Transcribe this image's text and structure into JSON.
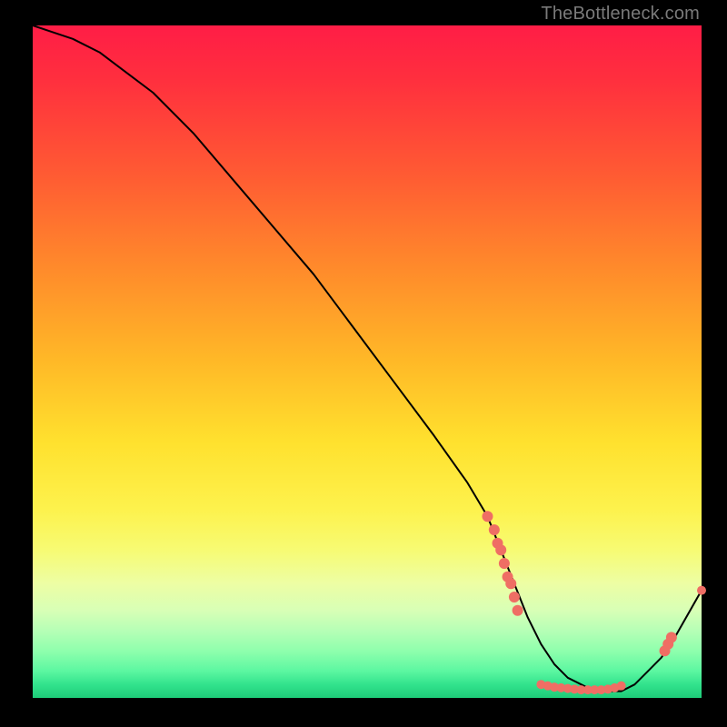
{
  "watermark": "TheBottleneck.com",
  "chart_data": {
    "type": "line",
    "title": "",
    "xlabel": "",
    "ylabel": "",
    "xlim": [
      0,
      100
    ],
    "ylim": [
      0,
      100
    ],
    "grid": false,
    "series": [
      {
        "name": "curve",
        "color": "#000000",
        "x": [
          0,
          3,
          6,
          10,
          14,
          18,
          24,
          30,
          36,
          42,
          48,
          54,
          60,
          65,
          68,
          70,
          72,
          74,
          76,
          78,
          80,
          82,
          84,
          86,
          88,
          90,
          92,
          94,
          96,
          100
        ],
        "y": [
          100,
          99,
          98,
          96,
          93,
          90,
          84,
          77,
          70,
          63,
          55,
          47,
          39,
          32,
          27,
          22,
          17,
          12,
          8,
          5,
          3,
          2,
          1,
          1,
          1,
          2,
          4,
          6,
          9,
          16
        ]
      }
    ],
    "markers": [
      {
        "name": "cluster-descent",
        "color": "#ef6e64",
        "radius_px": 6,
        "points": [
          [
            68,
            27
          ],
          [
            69,
            25
          ],
          [
            69.5,
            23
          ],
          [
            70,
            22
          ],
          [
            70.5,
            20
          ],
          [
            71,
            18
          ],
          [
            71.5,
            17
          ],
          [
            72,
            15
          ],
          [
            72.5,
            13
          ]
        ]
      },
      {
        "name": "cluster-valley",
        "color": "#ef6e64",
        "radius_px": 5,
        "points": [
          [
            76,
            2.0
          ],
          [
            77,
            1.8
          ],
          [
            78,
            1.6
          ],
          [
            79,
            1.5
          ],
          [
            80,
            1.4
          ],
          [
            81,
            1.3
          ],
          [
            82,
            1.2
          ],
          [
            83,
            1.2
          ],
          [
            84,
            1.2
          ],
          [
            85,
            1.2
          ],
          [
            86,
            1.3
          ],
          [
            87,
            1.5
          ],
          [
            88,
            1.8
          ]
        ]
      },
      {
        "name": "cluster-ascent",
        "color": "#ef6e64",
        "radius_px": 6,
        "points": [
          [
            94.5,
            7
          ],
          [
            95,
            8
          ],
          [
            95.5,
            9
          ]
        ]
      },
      {
        "name": "end-point",
        "color": "#ef6e64",
        "radius_px": 5,
        "points": [
          [
            100,
            16
          ]
        ]
      }
    ]
  }
}
